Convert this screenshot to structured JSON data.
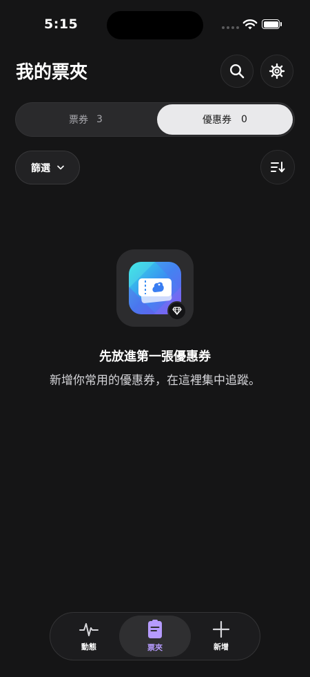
{
  "status_bar": {
    "time": "5:15"
  },
  "header": {
    "title": "我的票夾"
  },
  "segments": {
    "tickets_label": "票券",
    "tickets_count": "3",
    "coupons_label": "優惠券",
    "coupons_count": "0",
    "selected": "coupons"
  },
  "filter": {
    "label": "篩選"
  },
  "empty_state": {
    "title": "先放進第一張優惠券",
    "subtitle": "新增你常用的優惠券，在這裡集中追蹤。"
  },
  "tabbar": {
    "tabs": [
      {
        "label": "動態",
        "icon": "activity-icon",
        "active": false
      },
      {
        "label": "票夾",
        "icon": "wallet-icon",
        "active": true
      },
      {
        "label": "新增",
        "icon": "plus-icon",
        "active": false
      }
    ]
  },
  "colors": {
    "background": "#151516",
    "accent": "#b69bff",
    "segment_active": "#e9e9eb"
  }
}
